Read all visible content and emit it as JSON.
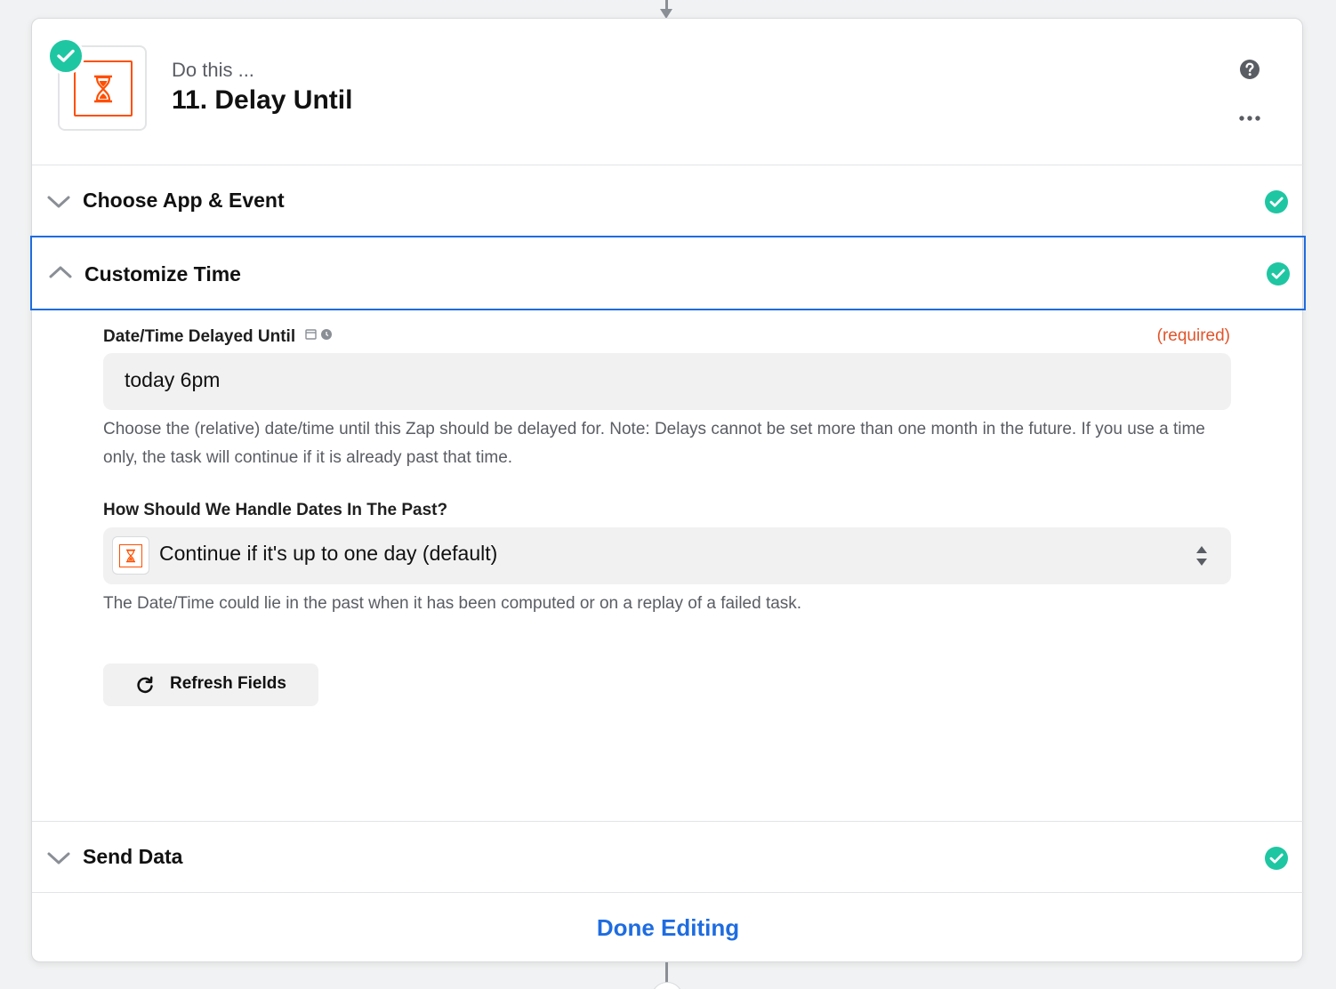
{
  "step": {
    "overline": "Do this ...",
    "title": "11. Delay Until",
    "app_icon": "hourglass-icon",
    "status": "complete"
  },
  "header_actions": {
    "help_icon": "question-circle-icon",
    "more_icon": "ellipsis-icon"
  },
  "sections": {
    "choose": {
      "title": "Choose App & Event",
      "expanded": false,
      "complete": true
    },
    "customize": {
      "title": "Customize Time",
      "expanded": true,
      "complete": true,
      "fields": {
        "datetime": {
          "label": "Date/Time Delayed Until",
          "required_text": "(required)",
          "value": "today 6pm",
          "help": "Choose the (relative) date/time until this Zap should be delayed for. Note: Delays cannot be set more than one month in the future. If you use a time only, the task will continue if it is already past that time."
        },
        "past_dates": {
          "label": "How Should We Handle Dates In The Past?",
          "value": "Continue if it's up to one day (default)",
          "help": "The Date/Time could lie in the past when it has been computed or on a replay of a failed task."
        }
      },
      "refresh_label": "Refresh Fields"
    },
    "send": {
      "title": "Send Data",
      "expanded": false,
      "complete": true
    }
  },
  "footer": {
    "done_label": "Done Editing"
  },
  "colors": {
    "accent_blue": "#1e6ce0",
    "success_green": "#1fc6a2",
    "brand_orange": "#ff4f00",
    "required_red": "#e2542a"
  }
}
